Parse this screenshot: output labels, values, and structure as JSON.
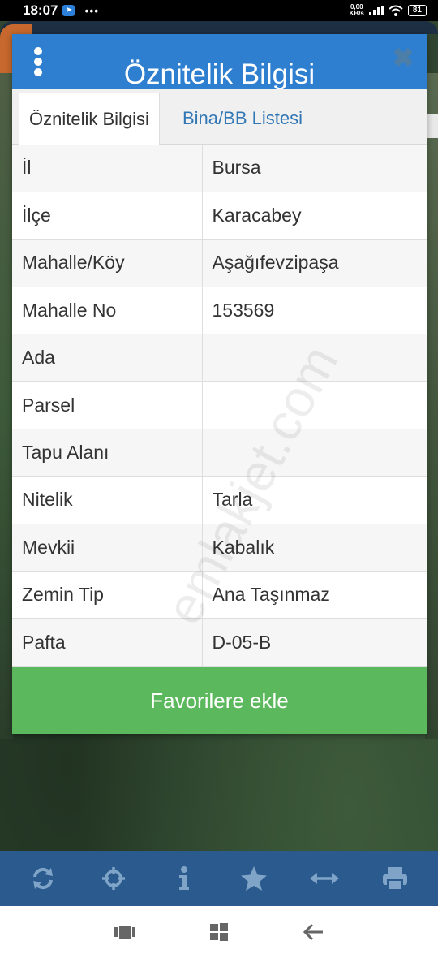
{
  "status_bar": {
    "time": "18:07",
    "dots": "•••",
    "net_speed_value": "0,00",
    "net_speed_unit": "KB/s",
    "battery": "81"
  },
  "dialog": {
    "title": "Öznitelik Bilgisi",
    "close_label": "✖",
    "tabs": [
      {
        "label": "Öznitelik Bilgisi",
        "active": true
      },
      {
        "label": "Bina/BB Listesi",
        "active": false
      }
    ],
    "rows": [
      {
        "key": "İl",
        "value": "Bursa"
      },
      {
        "key": "İlçe",
        "value": "Karacabey"
      },
      {
        "key": "Mahalle/Köy",
        "value": "Aşağıfevzipaşa"
      },
      {
        "key": "Mahalle No",
        "value": "153569"
      },
      {
        "key": "Ada",
        "value": ""
      },
      {
        "key": "Parsel",
        "value": ""
      },
      {
        "key": "Tapu Alanı",
        "value": ""
      },
      {
        "key": "Nitelik",
        "value": "Tarla"
      },
      {
        "key": "Mevkii",
        "value": "Kabalık"
      },
      {
        "key": "Zemin Tip",
        "value": "Ana Taşınmaz"
      },
      {
        "key": "Pafta",
        "value": "D-05-B"
      }
    ],
    "favorite_button": "Favorilere ekle"
  },
  "watermark": "emlakjet.com",
  "toolbar": {
    "icons": [
      "refresh-icon",
      "locate-crosshair-icon",
      "info-icon",
      "star-icon",
      "measure-arrows-icon",
      "print-icon"
    ],
    "color": "#2a5a8e",
    "icon_color": "#7fa4c8"
  },
  "colors": {
    "header": "#2f7fd1",
    "favorite_button": "#5cb85c",
    "tab_inactive_text": "#3277b5"
  }
}
